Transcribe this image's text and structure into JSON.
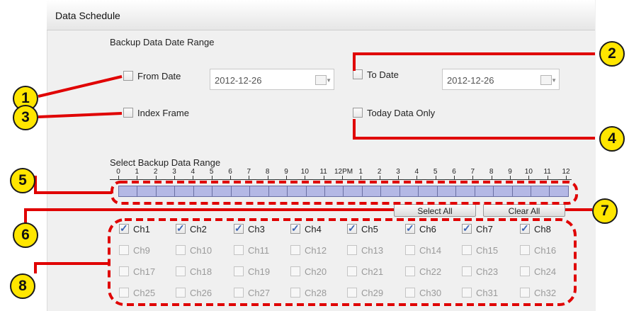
{
  "section_title": "Data Schedule",
  "backup_date_range_label": "Backup Data Date Range",
  "from_date": {
    "label": "From Date",
    "value": "2012-12-26"
  },
  "to_date": {
    "label": "To Date",
    "value": "2012-12-26"
  },
  "index_frame": {
    "label": "Index Frame"
  },
  "today_data_only": {
    "label": "Today Data Only"
  },
  "select_backup_range_label": "Select Backup Data Range",
  "ruler_ticks": [
    "0",
    "1",
    "2",
    "3",
    "4",
    "5",
    "6",
    "7",
    "8",
    "9",
    "10",
    "11",
    "12PM",
    "1",
    "2",
    "3",
    "4",
    "5",
    "6",
    "7",
    "8",
    "9",
    "10",
    "11",
    "12"
  ],
  "buttons": {
    "select_all": "Select All",
    "clear_all": "Clear All"
  },
  "channels": {
    "row1": [
      "Ch1",
      "Ch2",
      "Ch3",
      "Ch4",
      "Ch5",
      "Ch6",
      "Ch7",
      "Ch8"
    ],
    "row2": [
      "Ch9",
      "Ch10",
      "Ch11",
      "Ch12",
      "Ch13",
      "Ch14",
      "Ch15",
      "Ch16"
    ],
    "row3": [
      "Ch17",
      "Ch18",
      "Ch19",
      "Ch20",
      "Ch21",
      "Ch22",
      "Ch23",
      "Ch24"
    ],
    "row4": [
      "Ch25",
      "Ch26",
      "Ch27",
      "Ch28",
      "Ch29",
      "Ch30",
      "Ch31",
      "Ch32"
    ]
  },
  "callouts": [
    "1",
    "2",
    "3",
    "4",
    "5",
    "6",
    "7",
    "8"
  ],
  "colors": {
    "callout_fill": "#ffe600",
    "annotation_red": "#e00000",
    "range_bar": "#b4b8e5"
  }
}
